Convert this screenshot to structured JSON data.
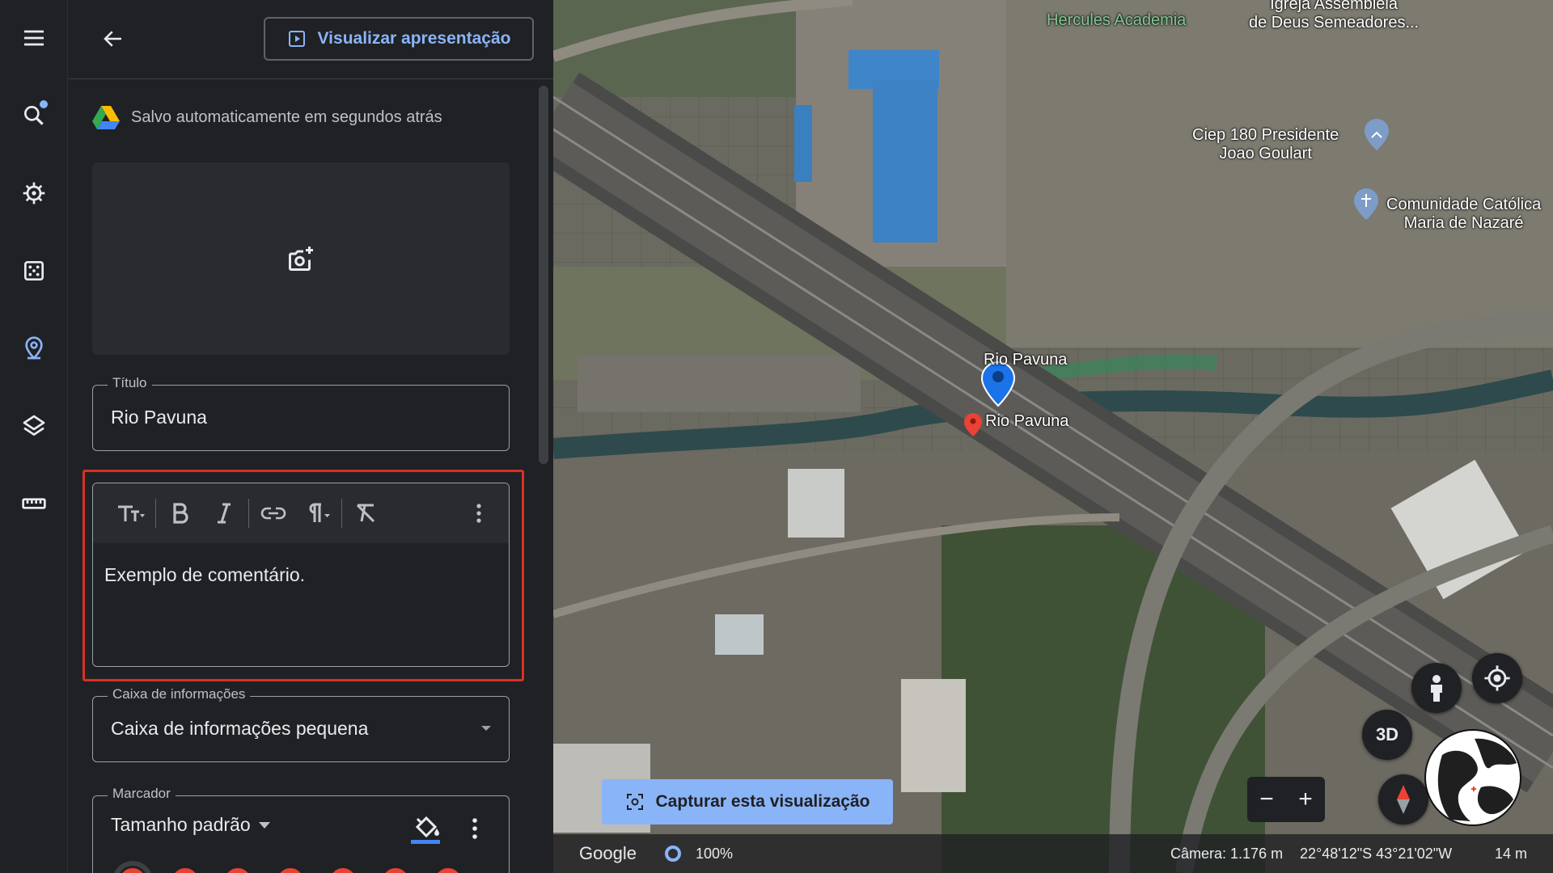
{
  "header": {
    "present_label": "Visualizar apresentação",
    "autosave_text": "Salvo automaticamente em segundos atrás"
  },
  "fields": {
    "title_label": "Título",
    "title_value": "Rio Pavuna",
    "comment_text": "Exemplo de comentário.",
    "infobox_label": "Caixa de informações",
    "infobox_value": "Caixa de informações pequena",
    "marker_label": "Marcador",
    "marker_size": "Tamanho padrão"
  },
  "colors": {
    "accent": "#8ab4f8",
    "highlight": "#d93025",
    "marker": "#e94235"
  },
  "map": {
    "labels": {
      "hercules": "Hercules Academia",
      "igreja": "Igreja Assembleia\nde Deus Semeadores...",
      "ciep": "Ciep 180 Presidente\nJoao Goulart",
      "comunidade": "Comunidade Católica\nMaria de Nazaré",
      "pin_blue": "Rio Pavuna",
      "pin_red": "Rio Pavuna"
    },
    "btn_3d": "3D",
    "capture_label": "Capturar esta visualização",
    "status": {
      "brand": "Google",
      "percent": "100%",
      "camera": "Câmera: 1.176 m",
      "coords": "22°48'12\"S 43°21'02\"W",
      "scale": "14 m"
    }
  }
}
